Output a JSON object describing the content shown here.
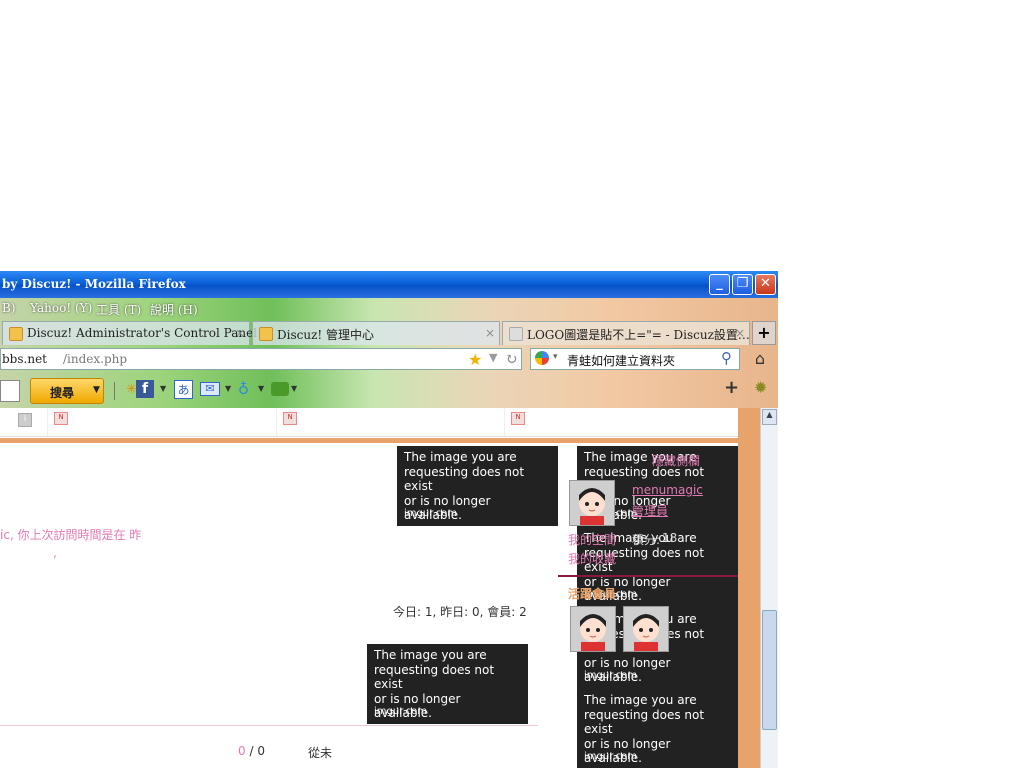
{
  "window": {
    "title": "by Discuz! - Mozilla Firefox",
    "buttons": {
      "minimize": "_",
      "restore": "❐",
      "close": "✕"
    }
  },
  "menubar": [
    "B)",
    "Yahoo! (Y)",
    "工具 (T)",
    "說明 (H)"
  ],
  "tabs": [
    {
      "label": "Discuz! Administrator's Control Panel",
      "close": "×"
    },
    {
      "label": "Discuz! 管理中心",
      "close": "×"
    },
    {
      "label": "LOGO圖還是貼不上=\"= - Discuz設置…",
      "close": "×"
    }
  ],
  "new_tab": "+",
  "url": {
    "host": "bbs.net",
    "path": "/index.php"
  },
  "search": {
    "value": "青蛙如何建立資料夾"
  },
  "toolbar": {
    "search_button": "搜尋"
  },
  "content": {
    "visit_text": "ic, 你上次訪問時間是在 昨",
    "comma": ",",
    "stats": "今日: 1, 昨日: 0, 會員: 2",
    "row_count_a": "0",
    "row_count_sep": " / ",
    "row_count_b": "0",
    "never": "從未",
    "image_notice": {
      "line1": "The image you are",
      "line2": "requesting does not exist",
      "line3": "or is no longer available.",
      "footer": "imgur.com"
    },
    "sidebar": {
      "hide_column": "隱藏側欄",
      "username": "menumagic",
      "role": "管理員",
      "my_space": "我的空間",
      "points_label": "積分:",
      "points_value": "18",
      "my_favorites": "我的收藏",
      "active_members": "活躍會員"
    }
  },
  "colors": {
    "accent": "#e8a36a",
    "link": "#e17ab2",
    "titlebar": "#0a5fd8"
  }
}
